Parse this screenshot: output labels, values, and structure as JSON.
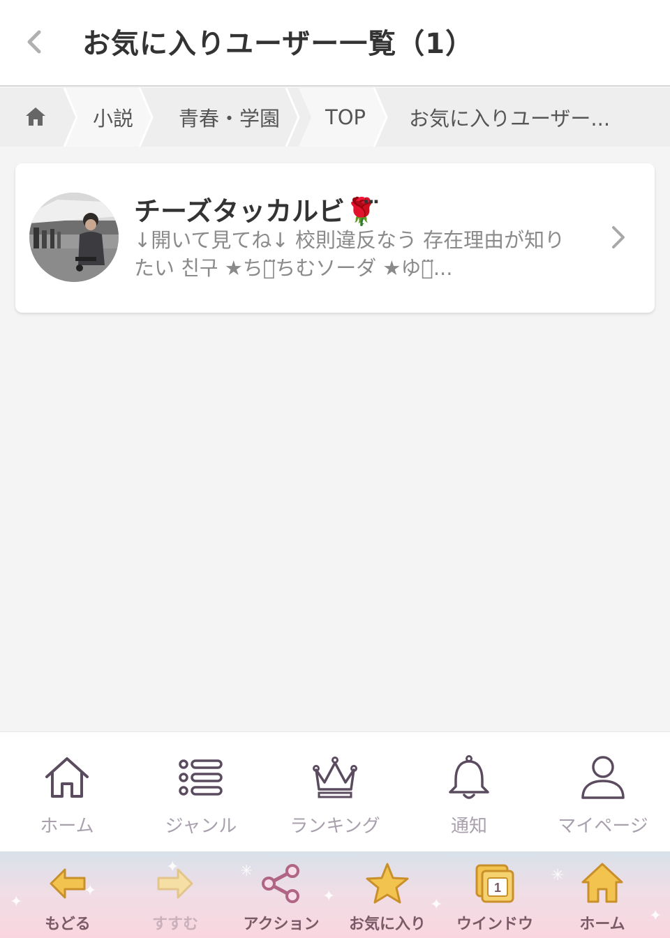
{
  "header": {
    "title": "お気に入りユーザー一覧（1）"
  },
  "breadcrumb": {
    "items": [
      "小説",
      "青春・学園",
      "TOP",
      "お気に入りユーザー..."
    ]
  },
  "users": [
    {
      "name": "チーズタッカルビ🌹⃛⃛",
      "bio": "↓開いて見てね↓ 校則違反なう 存在理由が知りたい 친구 ★ちめ⃛⃛ちむソーダ ★ゆな⃛..."
    }
  ],
  "tabbar": {
    "items": [
      {
        "label": "ホーム",
        "icon": "home-icon"
      },
      {
        "label": "ジャンル",
        "icon": "list-icon"
      },
      {
        "label": "ランキング",
        "icon": "crown-icon"
      },
      {
        "label": "通知",
        "icon": "bell-icon"
      },
      {
        "label": "マイページ",
        "icon": "person-icon"
      }
    ]
  },
  "toolbar": {
    "items": [
      {
        "label": "もどる",
        "icon": "arrow-left-icon"
      },
      {
        "label": "すすむ",
        "icon": "arrow-right-icon"
      },
      {
        "label": "アクション",
        "icon": "share-icon"
      },
      {
        "label": "お気に入り",
        "icon": "star-icon"
      },
      {
        "label": "ウインドウ",
        "icon": "window-icon"
      },
      {
        "label": "ホーム",
        "icon": "house-icon"
      }
    ],
    "window_count": "1"
  },
  "colors": {
    "accent": "#a8a0ad",
    "toolbar_label": "#7a5a66",
    "icon_stroke": "#5b4b5f"
  }
}
